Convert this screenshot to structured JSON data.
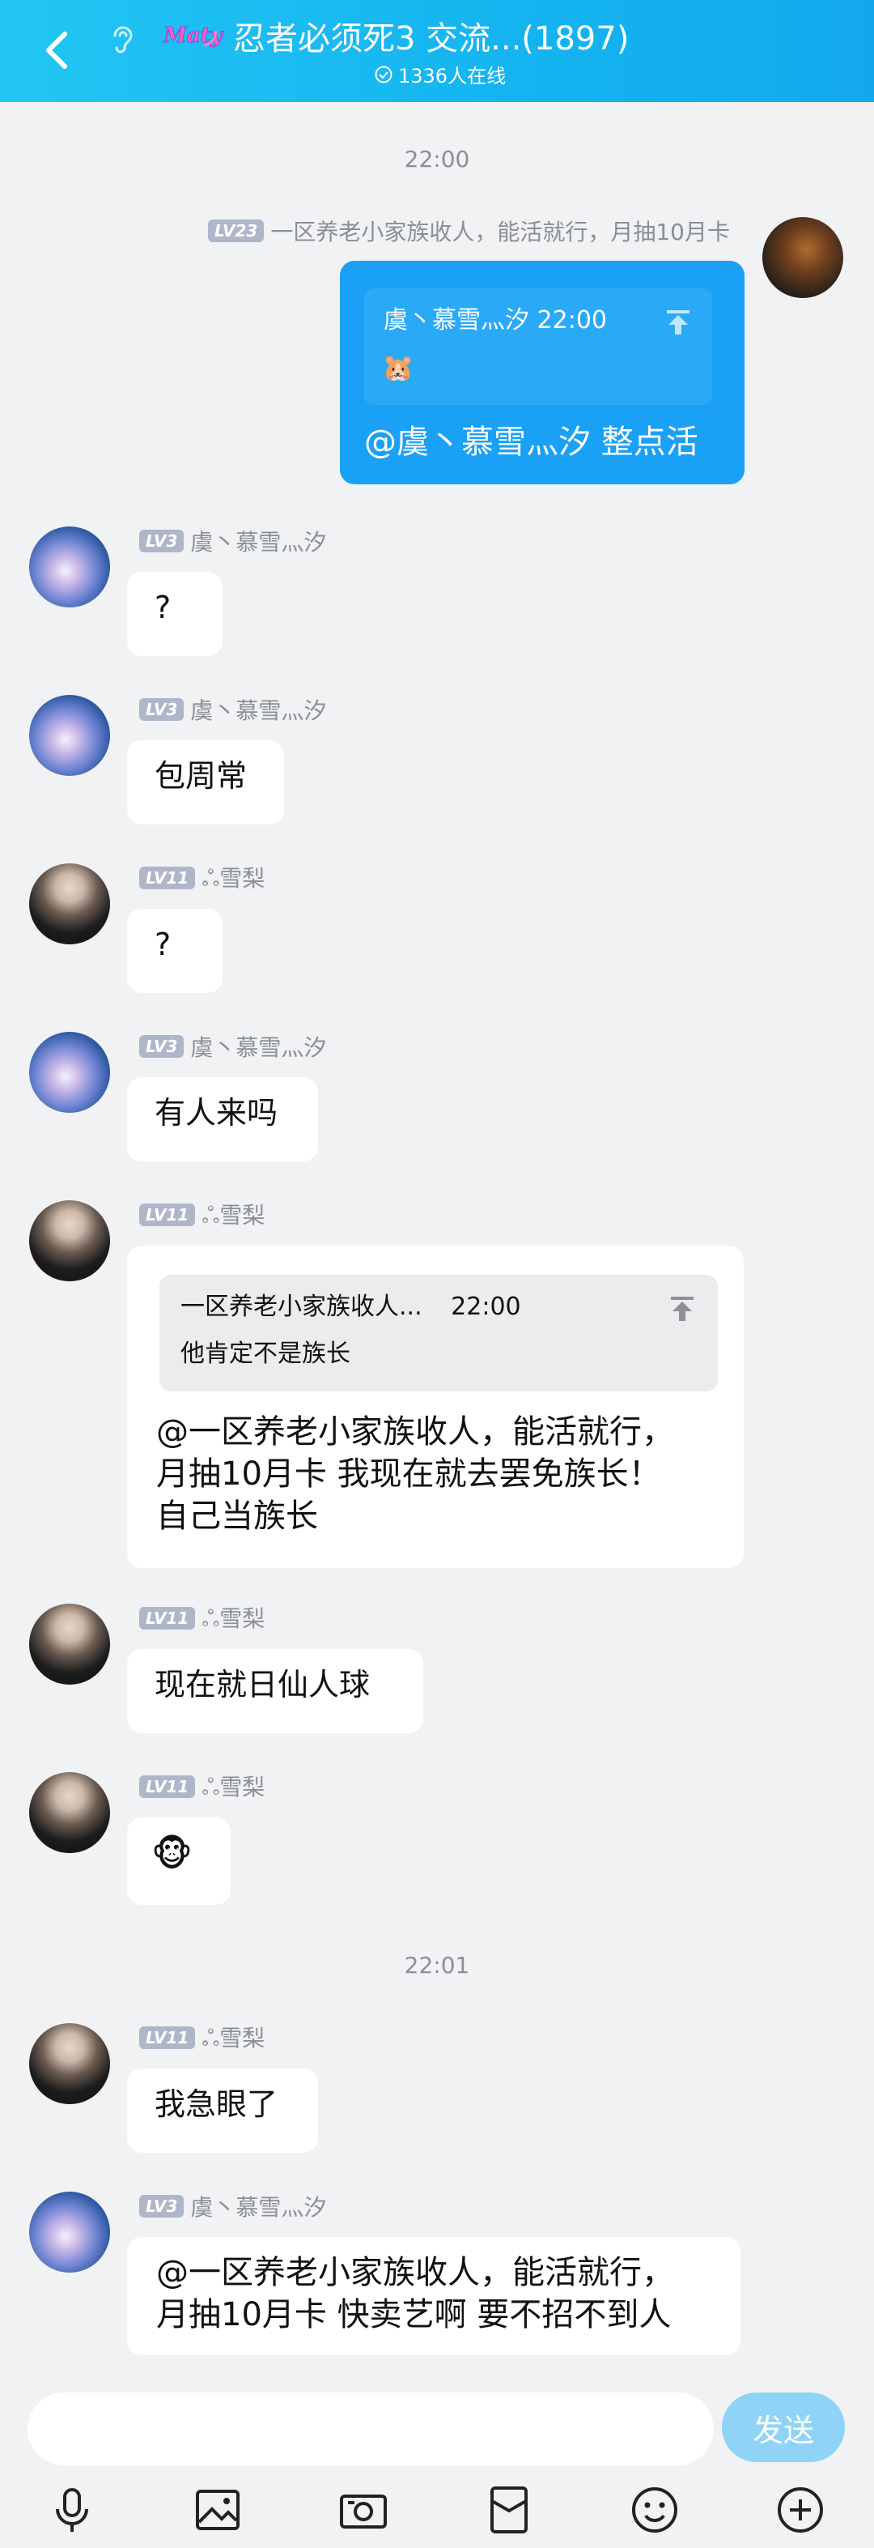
{
  "header": {
    "title": "忍者必须死3 交流...(1897)",
    "online_text": "1336人在线",
    "badge_text": "Maty"
  },
  "timestamps": [
    "22:00",
    "22:01"
  ],
  "messages": {
    "m1": {
      "level": "LV23",
      "name": "一区养老小家族收人，能活就行，月抽10月卡",
      "quote_name_time": "虞丶慕雪灬汐 22:00",
      "quote_emoji": "🐹",
      "text": "@虞丶慕雪灬汐 整点活"
    },
    "m2": {
      "level": "LV3",
      "name": "虞丶慕雪灬汐",
      "text": "?"
    },
    "m3": {
      "level": "LV3",
      "name": "虞丶慕雪灬汐",
      "text": "包周常"
    },
    "m4": {
      "level": "LV11",
      "name": "ஃ雪梨",
      "text": "?"
    },
    "m5": {
      "level": "LV3",
      "name": "虞丶慕雪灬汐",
      "text": "有人来吗"
    },
    "m6": {
      "level": "LV11",
      "name": "ஃ雪梨",
      "quote_name": "一区养老小家族收人...",
      "quote_time": "22:00",
      "quote_text": "他肯定不是族长",
      "line1": "@一区养老小家族收人，能活就行，",
      "line2": "月抽10月卡 我现在就去罢免族长！",
      "line3": "自己当族长"
    },
    "m7": {
      "level": "LV11",
      "name": "ஃ雪梨",
      "text": "现在就日仙人球"
    },
    "m8": {
      "level": "LV11",
      "name": "ஃ雪梨",
      "text": "🐵"
    },
    "m9": {
      "level": "LV11",
      "name": "ஃ雪梨",
      "text": "我急眼了"
    },
    "m10": {
      "level": "LV3",
      "name": "虞丶慕雪灬汐",
      "line1": "@一区养老小家族收人，能活就行，",
      "line2": "月抽10月卡 快卖艺啊 要不招不到人"
    }
  },
  "input": {
    "placeholder": "",
    "send_label": "发送"
  },
  "toolbar_icons": [
    "mic-icon",
    "picture-icon",
    "camera-icon",
    "red-packet-icon",
    "emoji-icon",
    "plus-icon"
  ],
  "colors": {
    "header": "#15b5f0",
    "self_bubble": "#1aa0f5",
    "send_button": "#8fd3f7",
    "level_badge": "#aeb6c9"
  }
}
